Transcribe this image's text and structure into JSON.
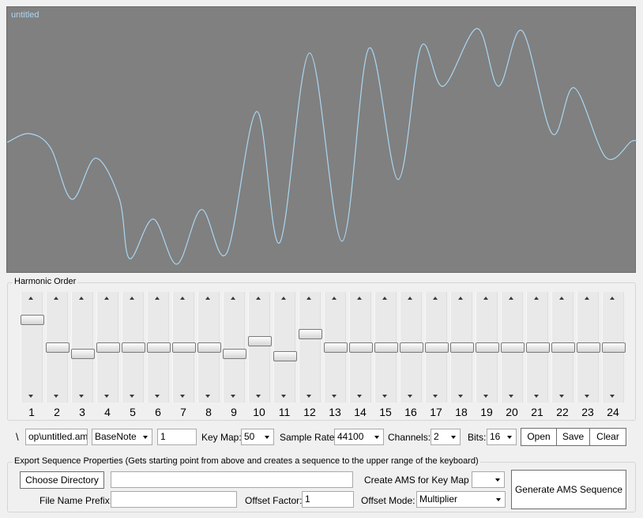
{
  "waveform": {
    "title": "untitled",
    "line_color": "#a9d7f2",
    "background": "#808080"
  },
  "harmonics": {
    "legend": "Harmonic Order",
    "levels": [
      0.82,
      0.5,
      0.42,
      0.5,
      0.5,
      0.5,
      0.5,
      0.5,
      0.42,
      0.57,
      0.39,
      0.65,
      0.5,
      0.5,
      0.5,
      0.5,
      0.5,
      0.5,
      0.5,
      0.5,
      0.5,
      0.5,
      0.5,
      0.5
    ],
    "labels": [
      "1",
      "2",
      "3",
      "4",
      "5",
      "6",
      "7",
      "8",
      "9",
      "10",
      "11",
      "12",
      "13",
      "14",
      "15",
      "16",
      "17",
      "18",
      "19",
      "20",
      "21",
      "22",
      "23",
      "24"
    ]
  },
  "settings": {
    "path_prefix": "\\",
    "file_path": "op\\untitled.ams",
    "base_note": "BaseNote",
    "base_value": "1",
    "key_map_label": "Key Map:",
    "key_map_value": "50",
    "sample_rate_label": "Sample Rate:",
    "sample_rate_value": "44100",
    "channels_label": "Channels:",
    "channels_value": "2",
    "bits_label": "Bits:",
    "bits_value": "16",
    "open_label": "Open",
    "save_label": "Save",
    "clear_label": "Clear"
  },
  "export": {
    "legend": "Export Sequence Properties (Gets starting point from above and creates a sequence to the upper range of the keyboard)",
    "choose_dir_label": "Choose Directory",
    "dir_value": "",
    "create_ams_label": "Create AMS for Key Map +",
    "create_ams_value": "",
    "generate_label": "Generate AMS Sequence",
    "prefix_label": "File Name Prefix:",
    "prefix_value": "",
    "offset_factor_label": "Offset Factor:",
    "offset_factor_value": "1",
    "offset_mode_label": "Offset Mode:",
    "offset_mode_value": "Multiplier"
  }
}
